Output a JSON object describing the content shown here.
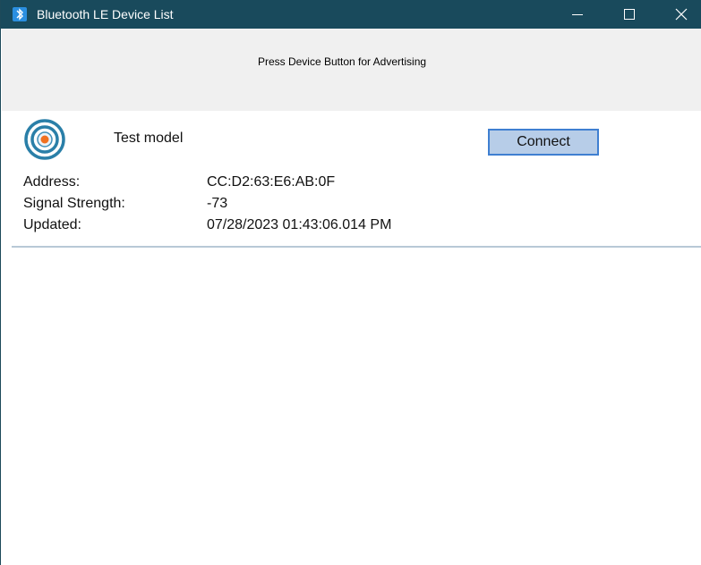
{
  "window": {
    "title": "Bluetooth LE Device List",
    "colors": {
      "titlebar": "#194a5c",
      "header_strip": "#f0f0f0",
      "connect_button_bg": "#b7cde8",
      "connect_button_border": "#3f7fd1",
      "signal_icon_ring": "#2a7fa8",
      "signal_icon_dot": "#f07020"
    },
    "controls": {
      "minimize_icon": "minimize-icon",
      "maximize_icon": "maximize-icon",
      "close_icon": "close-icon"
    }
  },
  "header": {
    "hint": "Press Device Button for Advertising"
  },
  "devices": [
    {
      "icon": "bluetooth-signal-icon",
      "name": "Test model",
      "connect_label": "Connect",
      "fields": [
        {
          "label": "Address:",
          "value": "CC:D2:63:E6:AB:0F"
        },
        {
          "label": "Signal Strength:",
          "value": "-73"
        },
        {
          "label": "Updated:",
          "value": "07/28/2023 01:43:06.014 PM"
        }
      ]
    }
  ]
}
